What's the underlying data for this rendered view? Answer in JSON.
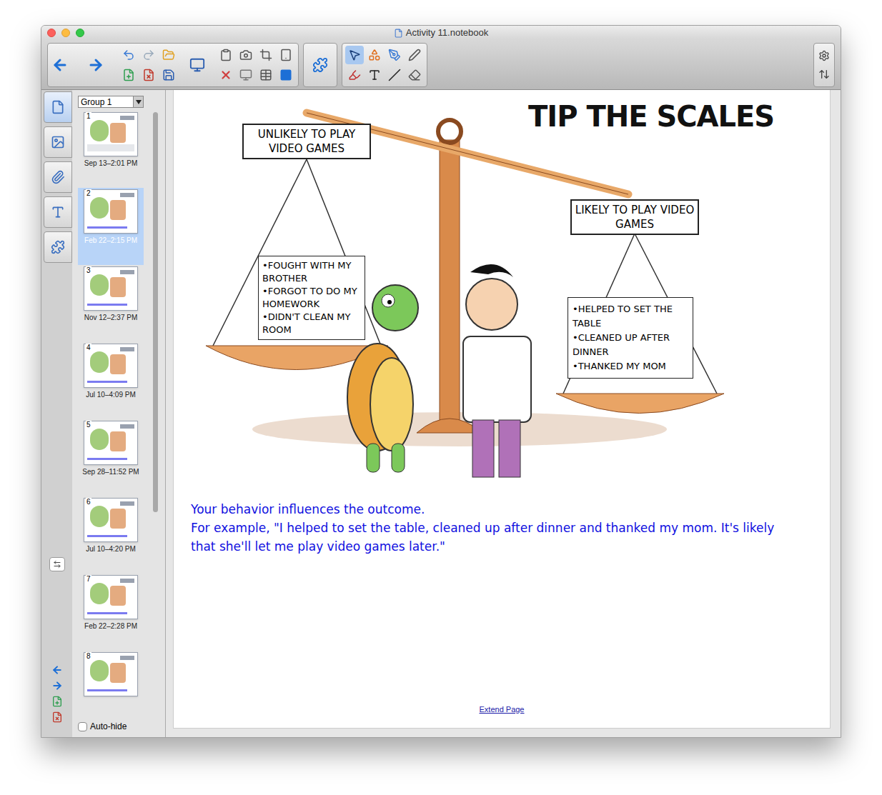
{
  "window": {
    "title": "Activity 11.notebook"
  },
  "side_tabs": [
    {
      "name": "page-sorter",
      "selected": true
    },
    {
      "name": "gallery",
      "selected": false
    },
    {
      "name": "attachments",
      "selected": false
    },
    {
      "name": "properties",
      "selected": false
    },
    {
      "name": "add-ons",
      "selected": false
    }
  ],
  "sorter": {
    "group": "Group 1",
    "pages": [
      {
        "number": "1",
        "date": "Sep 13–2:01 PM",
        "selected": false
      },
      {
        "number": "2",
        "date": "Feb 22–2:15 PM",
        "selected": true
      },
      {
        "number": "3",
        "date": "Nov 12–2:37 PM",
        "selected": false
      },
      {
        "number": "4",
        "date": "Jul 10–4:09 PM",
        "selected": false
      },
      {
        "number": "5",
        "date": "Sep 28–11:52 PM",
        "selected": false
      },
      {
        "number": "6",
        "date": "Jul 10–4:20 PM",
        "selected": false
      },
      {
        "number": "7",
        "date": "Feb 22–2:28 PM",
        "selected": false
      },
      {
        "number": "8",
        "selected": false
      }
    ],
    "auto_hide": {
      "label": "Auto-hide",
      "checked": false
    }
  },
  "page": {
    "cartoon": {
      "title": "TIP THE SCALES",
      "left_sign": "UNLIKELY TO PLAY VIDEO GAMES",
      "right_sign": "LIKELY TO PLAY VIDEO GAMES",
      "left_list": [
        "•FOUGHT WITH MY BROTHER",
        "•FORGOT TO DO MY HOMEWORK",
        "•DIDN'T CLEAN MY ROOM"
      ],
      "right_list": [
        "•HELPED TO SET THE TABLE",
        "•CLEANED UP AFTER DINNER",
        "•THANKED MY MOM"
      ]
    },
    "caption": [
      "Your behavior influences the outcome.",
      "For example, \"I helped to set the table, cleaned up after dinner and thanked my mom.  It's likely that she'll let me play video games later.\""
    ],
    "extend_link": "Extend Page"
  }
}
